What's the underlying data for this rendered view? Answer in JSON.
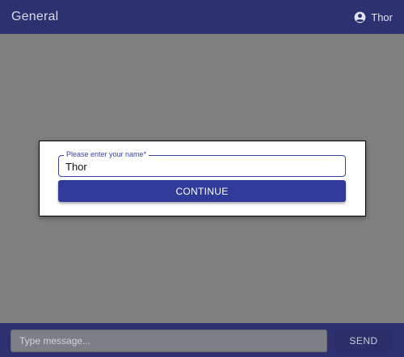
{
  "header": {
    "title": "General",
    "user_icon": "account-circle-icon",
    "user_name": "Thor"
  },
  "dialog": {
    "name_field": {
      "label": "Please enter your name",
      "required_marker": "*",
      "value": "Thor"
    },
    "continue_label": "CONTINUE"
  },
  "composer": {
    "placeholder": "Type message...",
    "send_label": "SEND"
  },
  "colors": {
    "appbar": "#2e3170",
    "primary": "#2f3a99",
    "overlay": "#808080"
  }
}
